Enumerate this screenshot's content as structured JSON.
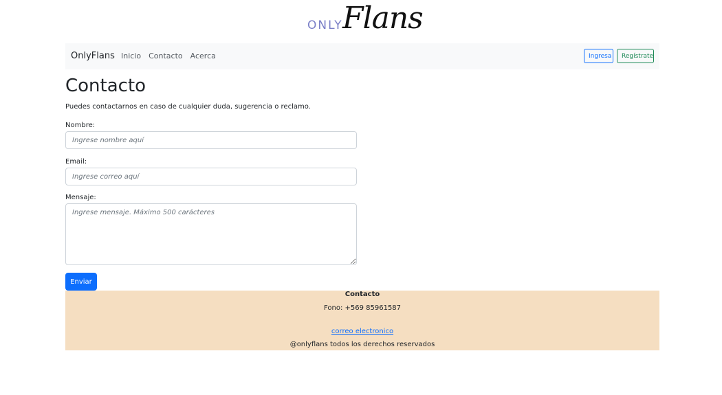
{
  "logo": {
    "only": "ONLY",
    "flans": "Flans"
  },
  "navbar": {
    "brand": "OnlyFlans",
    "links": [
      "Inicio",
      "Contacto",
      "Acerca"
    ],
    "login_label": "Ingresa",
    "register_label": "Regístrate"
  },
  "page": {
    "title": "Contacto",
    "subtitle": "Puedes contactarnos en caso de cualquier duda, sugerencia o reclamo."
  },
  "form": {
    "name_label": "Nombre:",
    "name_placeholder": "Ingrese nombre aquí",
    "email_label": "Email:",
    "email_placeholder": "Ingrese correo aquí",
    "message_label": "Mensaje:",
    "message_placeholder": "Ingrese mensaje. Máximo 500 carácteres",
    "submit_label": "Enviar"
  },
  "footer": {
    "title": "Contacto",
    "phone": "Fono: +569 85961587",
    "email_link": "correo electronico",
    "copyright": "@onlyflans todos los derechos reservados"
  },
  "colors": {
    "primary": "#0d6efd",
    "success": "#198754",
    "navbar_bg": "#f8f9fa",
    "footer_bg": "#f5dec1"
  }
}
